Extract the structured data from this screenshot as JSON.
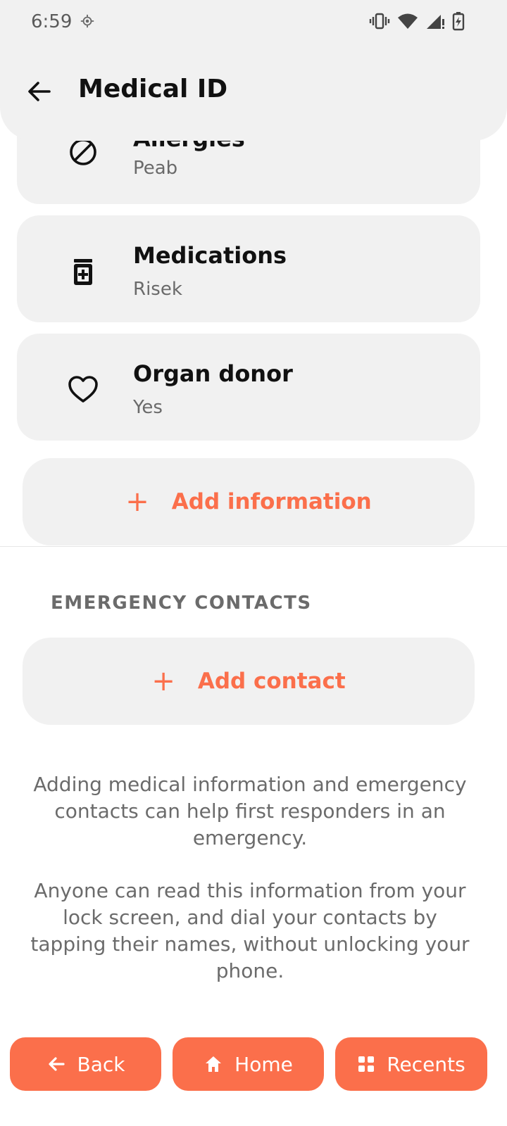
{
  "status_bar": {
    "time": "6:59"
  },
  "app_bar": {
    "title": "Medical ID"
  },
  "cards": [
    {
      "label": "Allergies",
      "value": "Peab",
      "icon": "no-allergy-icon"
    },
    {
      "label": "Medications",
      "value": "Risek",
      "icon": "medication-icon"
    },
    {
      "label": "Organ donor",
      "value": "Yes",
      "icon": "heart-icon"
    }
  ],
  "add_information_label": "Add information",
  "emergency_contacts": {
    "header": "EMERGENCY CONTACTS",
    "add_contact_label": "Add contact"
  },
  "info": {
    "paragraph1": "Adding medical information and emergency contacts can help first responders in an emergency.",
    "paragraph2": "Anyone can read this information from your lock screen, and dial your contacts by tapping their names, without unlocking your phone."
  },
  "nav": {
    "back": "Back",
    "home": "Home",
    "recents": "Recents"
  },
  "colors": {
    "accent": "#fb6f4b",
    "card_bg": "#f1f1f1"
  }
}
